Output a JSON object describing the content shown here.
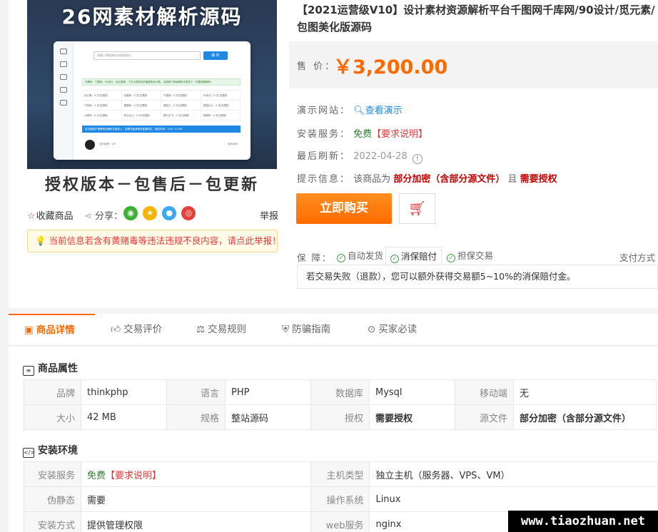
{
  "hero": {
    "title": "26网素材解析源码",
    "subtitle": "授权版本－包售后－包更新",
    "mock": {
      "search_placeholder": "请输入需要解析的链接地址",
      "search_button": "解 析",
      "notice": "可解析：千图网、90设计、觅元素等，下方为您购买的套餐剩余次数，当前账户剩余解析次数如下（不要频繁解析）",
      "cells": [
        "觅元素：0 次/无限制",
        "包图网：0 次/无限制",
        "千图网：0 次/无限制",
        "90设计：0 次/无限制",
        "千库网：0 次/无限制",
        "摄图网：0 次/无限制",
        "图品汇：0 次/无限制",
        "熊猫办公：0 次/无限制",
        "六图网：0 次/无限制",
        "风云办公：0 次/无限制",
        "图行天下：0 次/无限制",
        "我图网：0 次/无限制"
      ],
      "bar": "您当前账户套餐剩余解析次数如上，如需充值请联系客服购买，服务时间：9:00~22:00",
      "footer_left": "我的套餐：VIP",
      "footer_right": "使用说明"
    }
  },
  "actions": {
    "favorite": "收藏商品",
    "share": "分享：",
    "report": "举报"
  },
  "warning": "当前信息若含有黄赌毒等违法违规不良内容，请点此举报！",
  "product": {
    "title": "【2021运营级V10】设计素材资源解析平台千图网千库网/90设计/觅元素/包图美化版源码",
    "price_label": "售 价：",
    "price": "￥3,200.00",
    "demo_label": "演示网站：",
    "demo_link": "查看演示",
    "install_label": "安装服务：",
    "install_free": "免费",
    "install_req": "【要求说明】",
    "refresh_label": "最后刷新：",
    "refresh_date": "2022-04-28",
    "tip_label": "提示信息：",
    "tip_text1": "该商品为",
    "tip_enc": "部分加密（含部分源文件）",
    "tip_and": "且",
    "tip_auth": "需要授权",
    "buy_button": "立即购买"
  },
  "guarantee": {
    "label": "保 障：",
    "items": [
      "自动发货",
      "消保赔付",
      "担保交易"
    ],
    "pay": "支付方式",
    "desc": "若交易失败（退款），您可以额外获得交易额5~10%的消保赔付金。"
  },
  "tabs": [
    "商品详情",
    "交易评价",
    "交易规则",
    "防骗指南",
    "买家必读"
  ],
  "attrs": {
    "title": "商品属性",
    "rows": [
      [
        [
          "品牌",
          "thinkphp"
        ],
        [
          "语言",
          "PHP"
        ],
        [
          "数据库",
          "Mysql"
        ],
        [
          "移动端",
          "无"
        ]
      ],
      [
        [
          "大小",
          "42 MB"
        ],
        [
          "规格",
          "整站源码"
        ],
        [
          "授权",
          "需要授权"
        ],
        [
          "源文件",
          "部分加密（含部分源文件）"
        ]
      ]
    ]
  },
  "env": {
    "title": "安装环境",
    "rows": [
      [
        [
          "安装服务",
          "免费【要求说明】"
        ],
        [
          "主机类型",
          "独立主机（服务器、VPS、VM）"
        ]
      ],
      [
        [
          "伪静态",
          "需要"
        ],
        [
          "操作系统",
          "Linux"
        ]
      ],
      [
        [
          "安装方式",
          "提供管理权限"
        ],
        [
          "web服务",
          "nginx"
        ]
      ]
    ]
  },
  "watermark": "www.tiaozhuan.net"
}
